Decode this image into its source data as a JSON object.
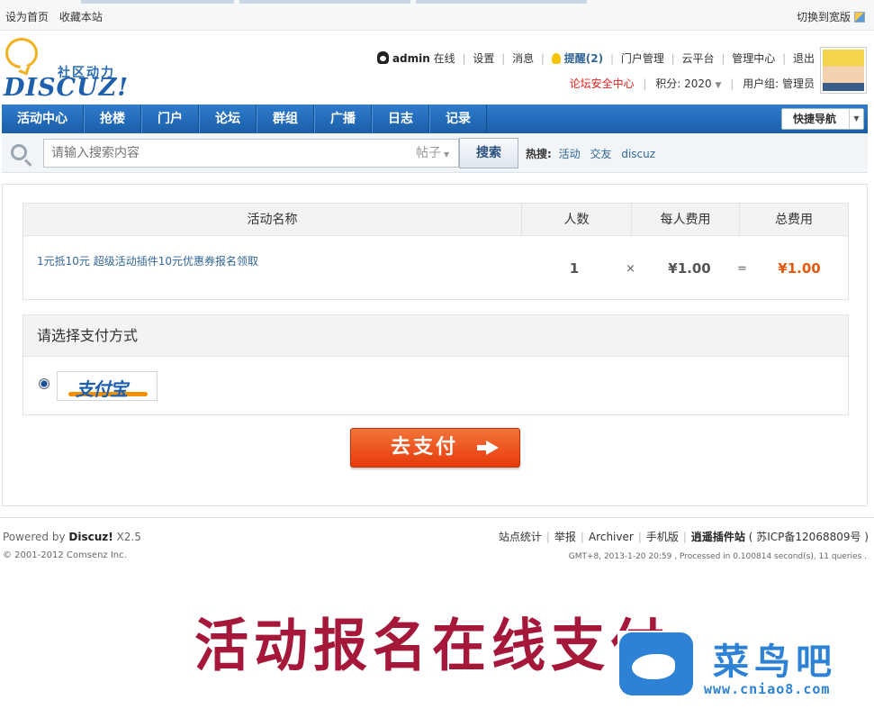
{
  "topbar": {
    "set_home": "设为首页",
    "bookmark": "收藏本站",
    "switch_wide": "切换到宽版"
  },
  "logo": {
    "slogan": "社区动力",
    "brand": "DISCUZ!"
  },
  "userbar": {
    "username": "admin",
    "online": "在线",
    "settings": "设置",
    "messages": "消息",
    "reminder": "提醒(2)",
    "portal_manage": "门户管理",
    "cloud": "云平台",
    "admin_center": "管理中心",
    "logout": "退出",
    "security_center": "论坛安全中心",
    "points": "积分: 2020",
    "usergroup": "用户组: 管理员"
  },
  "nav": {
    "items": [
      "活动中心",
      "抢楼",
      "门户",
      "论坛",
      "群组",
      "广播",
      "日志",
      "记录"
    ],
    "quick_nav": "快捷导航"
  },
  "search": {
    "placeholder": "请输入搜索内容",
    "type": "帖子",
    "button": "搜索",
    "hot_label": "热搜:",
    "hot_keywords": [
      "活动",
      "交友",
      "discuz"
    ]
  },
  "order": {
    "headers": {
      "name": "活动名称",
      "count": "人数",
      "per_fee": "每人费用",
      "total_fee": "总费用"
    },
    "row": {
      "name": "1元抵10元 超级活动插件10元优惠券报名领取",
      "count": "1",
      "times": "×",
      "per_fee": "¥1.00",
      "equals": "=",
      "total_fee": "¥1.00"
    }
  },
  "payment": {
    "title": "请选择支付方式",
    "method": "支付宝",
    "submit": "去支付"
  },
  "footer": {
    "powered_prefix": "Powered by ",
    "powered_brand": "Discuz!",
    "powered_version": " X2.5",
    "copyright": "© 2001-2012 Comsenz Inc.",
    "links": [
      "站点统计",
      "举报",
      "Archiver",
      "手机版"
    ],
    "site_name": "逍遥插件站",
    "icp": "( 苏ICP备12068809号 )",
    "meta": "GMT+8, 2013-1-20 20:59 , Processed in 0.100814 second(s), 11 queries ."
  },
  "banner": {
    "text": "活动报名在线支付",
    "watermark_name": "菜鸟吧",
    "watermark_url": "www.cniao8.com"
  },
  "colors": {
    "nav_blue": "#1b5ea8",
    "link_blue": "#336699",
    "total_orange": "#e4590f",
    "pay_button": "#e53a0c",
    "banner_red": "#a6183a"
  }
}
